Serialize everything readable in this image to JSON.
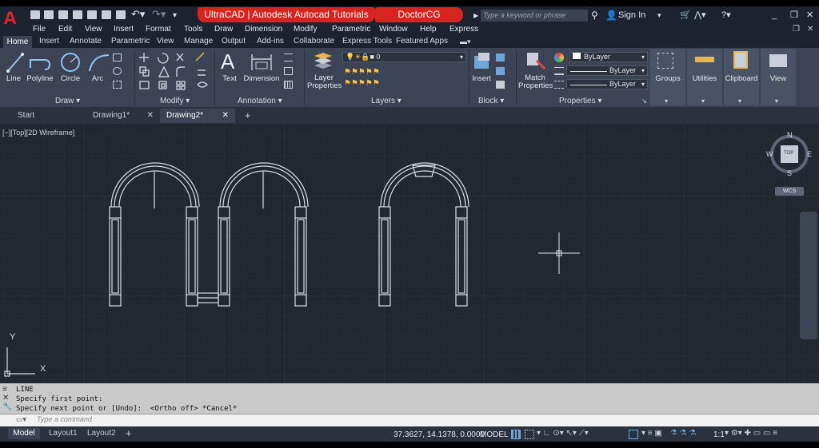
{
  "title_bar": {
    "app_title": "UltraCAD | Autodesk Autocad Tutorials",
    "channel": "DoctorCG",
    "search_placeholder": "Type a keyword or phrase",
    "sign_in": "Sign In"
  },
  "menu": [
    "File",
    "Edit",
    "View",
    "Insert",
    "Format",
    "Tools",
    "Draw",
    "Dimension",
    "Modify",
    "Parametric",
    "Window",
    "Help",
    "Express"
  ],
  "ribbon_tabs": [
    "Home",
    "Insert",
    "Annotate",
    "Parametric",
    "View",
    "Manage",
    "Output",
    "Add-ins",
    "Collaborate",
    "Express Tools",
    "Featured Apps"
  ],
  "ribbon": {
    "draw_tools": [
      "Line",
      "Polyline",
      "Circle",
      "Arc"
    ],
    "draw_panel": "Draw",
    "modify_panel": "Modify",
    "annotation_tools": [
      "Text",
      "Dimension"
    ],
    "annotation_panel": "Annotation",
    "layer_properties": "Layer Properties",
    "layer_value": "0",
    "layers_panel": "Layers",
    "insert": "Insert",
    "block_panel": "Block",
    "match_properties": "Match Properties",
    "bylayer": [
      "ByLayer",
      "ByLayer",
      "ByLayer"
    ],
    "properties_panel": "Properties",
    "groups": "Groups",
    "utilities": "Utilities",
    "clipboard": "Clipboard",
    "view": "View"
  },
  "file_tabs": [
    "Start",
    "Drawing1*",
    "Drawing2*"
  ],
  "viewport_label": "[−][Top][2D Wireframe]",
  "viewcube": {
    "n": "N",
    "s": "S",
    "e": "E",
    "w": "W",
    "top": "TOP",
    "wcs": "WCS"
  },
  "ucs": {
    "x": "X",
    "y": "Y"
  },
  "command": {
    "history": [
      "LINE",
      "Specify first point:",
      "Specify next point or [Undo]:  <Ortho off> *Cancel*"
    ],
    "placeholder": "Type  a  command"
  },
  "layouts": [
    "Model",
    "Layout1",
    "Layout2"
  ],
  "status": {
    "coords": "37.3627, 14.1378, 0.0000",
    "space": "MODEL",
    "scale": "1:1"
  },
  "colors": {
    "accent_red": "#d8241f",
    "canvas": "#212830",
    "ribbon": "#3b4354"
  }
}
